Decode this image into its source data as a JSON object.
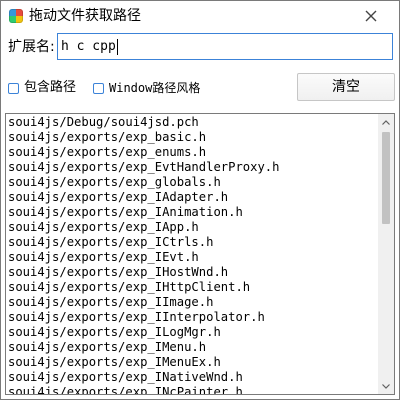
{
  "window": {
    "title": "拖动文件获取路径"
  },
  "extension": {
    "label": "扩展名:",
    "value": "h c cpp"
  },
  "options": {
    "include_path": {
      "label": "包含路径",
      "checked": false
    },
    "windows_style": {
      "label": "Window路径风格",
      "checked": false
    }
  },
  "clear_button": {
    "label": "清空"
  },
  "file_list": [
    "soui4js/Debug/soui4jsd.pch",
    "soui4js/exports/exp_basic.h",
    "soui4js/exports/exp_enums.h",
    "soui4js/exports/exp_EvtHandlerProxy.h",
    "soui4js/exports/exp_globals.h",
    "soui4js/exports/exp_IAdapter.h",
    "soui4js/exports/exp_IAnimation.h",
    "soui4js/exports/exp_IApp.h",
    "soui4js/exports/exp_ICtrls.h",
    "soui4js/exports/exp_IEvt.h",
    "soui4js/exports/exp_IHostWnd.h",
    "soui4js/exports/exp_IHttpClient.h",
    "soui4js/exports/exp_IImage.h",
    "soui4js/exports/exp_IInterpolator.h",
    "soui4js/exports/exp_ILogMgr.h",
    "soui4js/exports/exp_IMenu.h",
    "soui4js/exports/exp_IMenuEx.h",
    "soui4js/exports/exp_INativeWnd.h",
    "soui4js/exports/exp_INcPainter.h"
  ],
  "icons": {
    "app": "app-icon",
    "close": "close-icon",
    "scroll_up": "scroll-up-arrow-icon",
    "scroll_down": "scroll-down-arrow-icon"
  },
  "colors": {
    "focus_border": "#3c83d8",
    "scroll_thumb": "#c2c2c2"
  }
}
